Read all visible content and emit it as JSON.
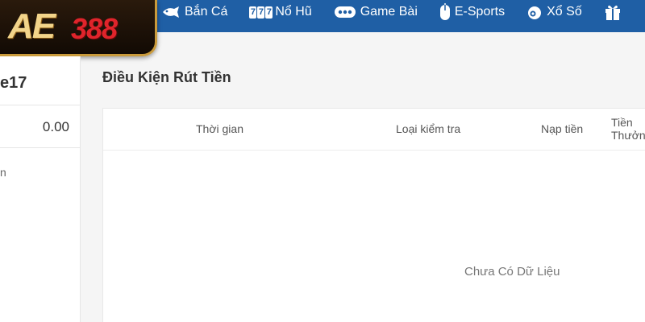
{
  "logo": {
    "prefix": "AE",
    "suffix": "388"
  },
  "nav": {
    "items": [
      {
        "label": "Bắn Cá",
        "icon": "fish-icon"
      },
      {
        "label": "Nổ Hũ",
        "icon": "slot-777-icon",
        "glyph": "777"
      },
      {
        "label": "Game Bài",
        "icon": "cards-icon"
      },
      {
        "label": "E-Sports",
        "icon": "mouse-icon"
      },
      {
        "label": "Xổ Số",
        "icon": "lottery-ball-icon"
      },
      {
        "label": "",
        "icon": "gift-icon"
      }
    ]
  },
  "left": {
    "name_fragment": "e17",
    "balance": "0.00",
    "item_fragment": "n"
  },
  "main": {
    "title": "Điều Kiện Rút Tiền",
    "columns": [
      "Thời gian",
      "Loại kiểm tra",
      "Nạp tiền",
      "Tiền Thưởng"
    ],
    "empty_text": "Chưa Có Dữ Liệu"
  },
  "colors": {
    "nav_bg": "#1f5fa5",
    "logo_gold": "#f2d48a",
    "logo_red": "#e0242b"
  }
}
